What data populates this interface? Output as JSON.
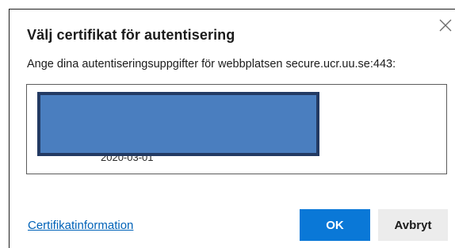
{
  "dialog": {
    "title": "Välj certifikat för autentisering",
    "subtitle": "Ange dina autentiseringsuppgifter för webbplatsen secure.ucr.uu.se:443:",
    "close_icon": "close-icon",
    "certificate": {
      "date_partial": "2020-03-01",
      "selected": true
    },
    "cert_info_link": "Certifikatinformation",
    "ok_label": "OK",
    "cancel_label": "Avbryt",
    "colors": {
      "primary": "#0a78d7",
      "link": "#0062b8",
      "redaction": "#4a7ebf"
    }
  }
}
